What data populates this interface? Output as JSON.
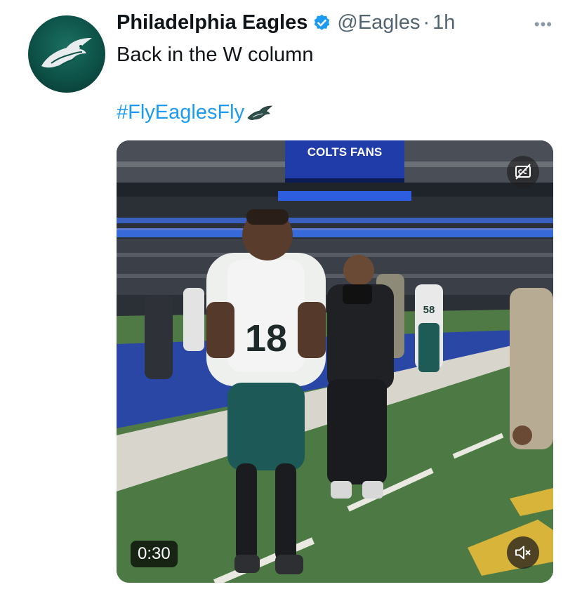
{
  "account": {
    "name": "Philadelphia Eagles",
    "handle": "@Eagles",
    "separator": "·",
    "time": "1h",
    "avatar_icon": "eagle-logo-icon",
    "verified_icon": "verified-badge-icon"
  },
  "tweet": {
    "text": "Back in the W column",
    "hashtag": "#FlyEaglesFly",
    "hashtag_emoji_icon": "eagle-emoji-icon"
  },
  "menu": {
    "more_label": "•••"
  },
  "media": {
    "duration": "0:30",
    "scoreboard_text": "COLTS FANS",
    "jersey_number": "18",
    "cc_icon": "closed-captions-icon",
    "mute_icon": "muted-speaker-icon"
  },
  "colors": {
    "brand_green": "#004c54",
    "link_blue": "#1d9bf0",
    "secondary_text": "#536471",
    "verified_blue": "#1d9bf0"
  }
}
